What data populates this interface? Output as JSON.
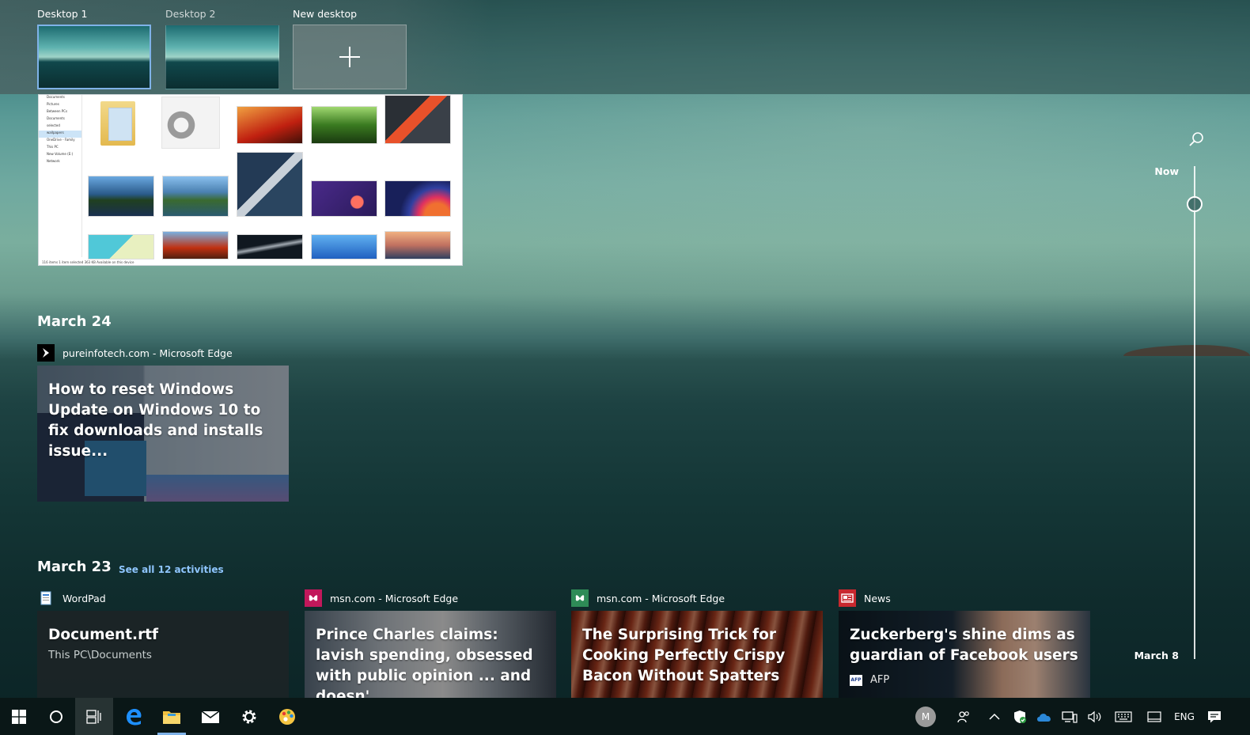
{
  "desktops": {
    "items": [
      {
        "label": "Desktop 1",
        "active": true
      },
      {
        "label": "Desktop 2",
        "active": false
      }
    ],
    "new_label": "New desktop"
  },
  "explorer_preview": {
    "nav_items": [
      "Documents",
      "Pictures",
      "Between PCs",
      "Documents",
      "selected",
      "wallpapers",
      "OneDrive - Family",
      "This PC",
      "New Volume (E:)",
      "Network"
    ],
    "status": "116 items   1 item selected  363 KB   Available on this device"
  },
  "timeline": {
    "sections": [
      {
        "date": "March 24",
        "cards": [
          {
            "app": "pureinfotech.com - Microsoft Edge",
            "title": "How to reset Windows Update on Windows 10 to fix downloads and installs issue..."
          }
        ]
      },
      {
        "date": "March 23",
        "see_all": "See all 12 activities",
        "cards": [
          {
            "app": "WordPad",
            "title": "Document.rtf",
            "subtitle": "This PC\\Documents"
          },
          {
            "app": "msn.com - Microsoft Edge",
            "title": "Prince Charles claims: lavish spending, obsessed with public opinion ... and doesn'..."
          },
          {
            "app": "msn.com - Microsoft Edge",
            "title": "The Surprising Trick for Cooking Perfectly Crispy Bacon Without Spatters"
          },
          {
            "app": "News",
            "title": "Zuckerberg's shine dims as guardian of Facebook users",
            "source": "AFP"
          }
        ]
      }
    ],
    "scrubber": {
      "now_label": "Now",
      "bottom_label": "March 8"
    }
  },
  "taskbar": {
    "language": "ENG",
    "avatar_initial": "M"
  }
}
